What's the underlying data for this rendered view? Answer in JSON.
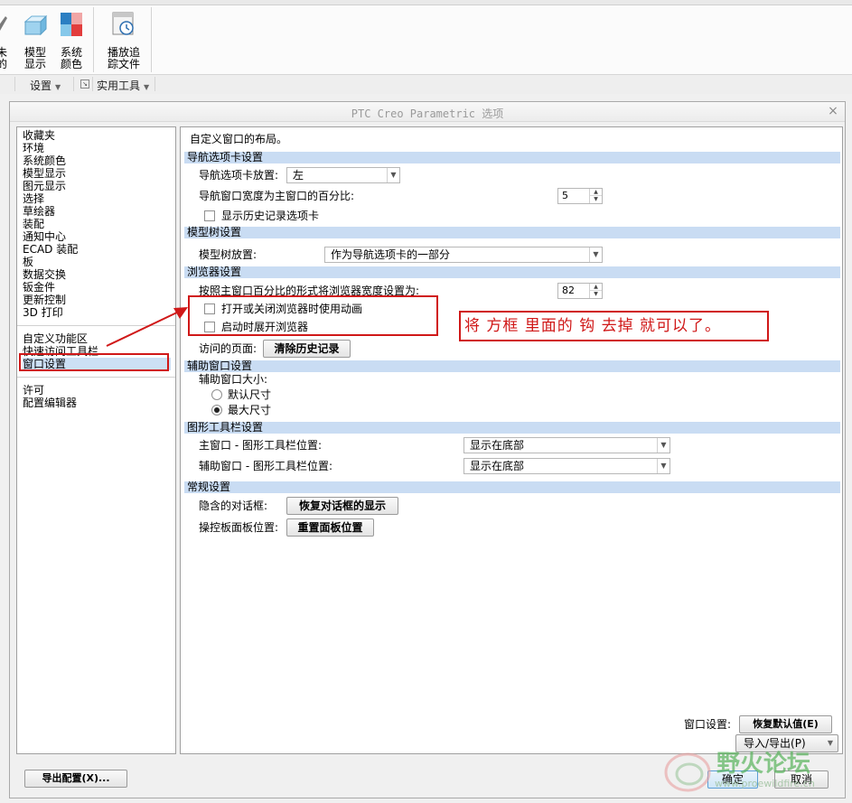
{
  "ribbon": {
    "partial_label": [
      "未",
      "的"
    ],
    "model_display": "模型\n显示",
    "model_display_l1": "模型",
    "model_display_l2": "显示",
    "system_colors_l1": "系统",
    "system_colors_l2": "颜色",
    "play_trail_l1": "播放追",
    "play_trail_l2": "踪文件",
    "group_settings": "设置",
    "group_utilities": "实用工具"
  },
  "dialog": {
    "title": "PTC Creo Parametric 选项",
    "categories_top": [
      "收藏夹",
      "环境",
      "系统颜色",
      "模型显示",
      "图元显示",
      "选择",
      "草绘器",
      "装配",
      "通知中心",
      "ECAD 装配",
      "板",
      "数据交换",
      "钣金件",
      "更新控制",
      "3D 打印"
    ],
    "categories_mid": [
      "自定义功能区",
      "快速访问工具栏",
      "窗口设置"
    ],
    "categories_bottom": [
      "许可",
      "配置编辑器"
    ],
    "selected_category": "窗口设置",
    "intro": "自定义窗口的布局。",
    "nav_section": {
      "header": "导航选项卡设置",
      "placement_label": "导航选项卡放置:",
      "placement_value": "左",
      "width_label": "导航窗口宽度为主窗口的百分比:",
      "width_value": "5",
      "history_label": "显示历史记录选项卡"
    },
    "tree_section": {
      "header": "模型树设置",
      "placement_label": "模型树放置:",
      "placement_value": "作为导航选项卡的一部分"
    },
    "browser_section": {
      "header": "浏览器设置",
      "width_label": "按照主窗口百分比的形式将浏览器宽度设置为:",
      "width_value": "82",
      "animate_label": "打开或关闭浏览器时使用动画",
      "expand_label": "启动时展开浏览器",
      "visited_label": "访问的页面:",
      "clear_history": "清除历史记录"
    },
    "aux_section": {
      "header": "辅助窗口设置",
      "size_label": "辅助窗口大小:",
      "default_size": "默认尺寸",
      "max_size": "最大尺寸"
    },
    "toolbar_section": {
      "header": "图形工具栏设置",
      "main_label": "主窗口 - 图形工具栏位置:",
      "main_value": "显示在底部",
      "aux_label": "辅助窗口 - 图形工具栏位置:",
      "aux_value": "显示在底部"
    },
    "general_section": {
      "header": "常规设置",
      "hidden_label": "隐含的对话框:",
      "restore_dialogs": "恢复对话框的显示",
      "dashboard_label": "操控板面板位置:",
      "reset_panels": "重置面板位置"
    },
    "footer": {
      "window_settings_label": "窗口设置:",
      "restore_defaults": "恢复默认值(E)",
      "import_export": "导入/导出(P)",
      "export_config": "导出配置(X)...",
      "ok": "确定",
      "cancel": "取消"
    }
  },
  "annotation": {
    "note": "将 方框 里面的 钩 去掉  就可以了。"
  },
  "watermark": {
    "text": "野火论坛",
    "url": "www.proewildfire.cn"
  },
  "colors": {
    "annotation_red": "#d01818",
    "section_header": "#c9dcf3",
    "selection": "#cce0f5"
  }
}
